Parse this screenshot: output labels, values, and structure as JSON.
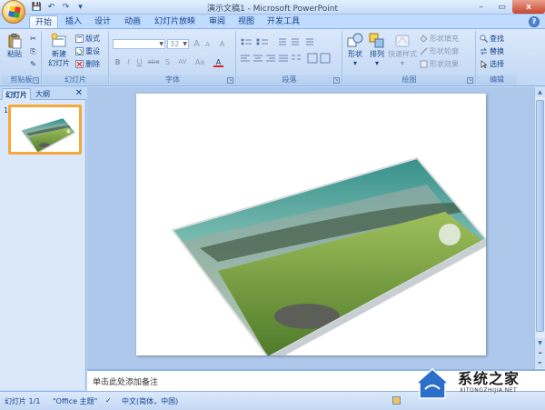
{
  "window": {
    "title": "演示文稿1 - Microsoft PowerPoint",
    "controls": {
      "minimize": "–",
      "restore": "▭",
      "close": "x"
    }
  },
  "qat": {
    "save": "💾",
    "undo": "↶",
    "redo": "↷",
    "more": "▾"
  },
  "tabs": [
    "开始",
    "插入",
    "设计",
    "动画",
    "幻灯片放映",
    "审阅",
    "视图",
    "开发工具"
  ],
  "active_tab": "开始",
  "ribbon": {
    "clipboard": {
      "paste": "粘贴",
      "cut": "✂",
      "copy": "⎘",
      "painter": "✎",
      "label": "剪贴板"
    },
    "slides": {
      "new_slide_line1": "新建",
      "new_slide_line2": "幻灯片",
      "layout": "版式",
      "reset": "重设",
      "delete": "删除",
      "label": "幻灯片"
    },
    "font": {
      "size": "32",
      "grow": "A",
      "shrink": "A",
      "clear": "A",
      "bold": "B",
      "italic": "I",
      "underline": "U",
      "strike": "abe",
      "shadow": "S",
      "spacing": "AV",
      "case": "Aa",
      "color": "A",
      "label": "字体"
    },
    "paragraph": {
      "label": "段落"
    },
    "drawing": {
      "shapes": "形状",
      "arrange": "排列",
      "quick_styles": "快速样式",
      "fill": "形状填充",
      "outline": "形状轮廓",
      "effects": "形状效果",
      "label": "绘图"
    },
    "editing": {
      "find": "查找",
      "replace": "替换",
      "select": "选择",
      "label": "编辑"
    }
  },
  "left_pane": {
    "tab_slides": "幻灯片",
    "tab_outline": "大纲",
    "close": "✕",
    "slide_number": "1"
  },
  "notes": {
    "placeholder": "单击此处添加备注"
  },
  "status": {
    "slide": "幻灯片 1/1",
    "theme": "\"Office 主题\"",
    "language": "中文(简体，中国)"
  },
  "watermark": {
    "brand": "系统之家",
    "url": "XITONGZHIJIA.NET"
  },
  "colors": {
    "ribbon": "#dbe8fa",
    "accent": "#15428b",
    "thumb_border": "#f6a93b"
  }
}
